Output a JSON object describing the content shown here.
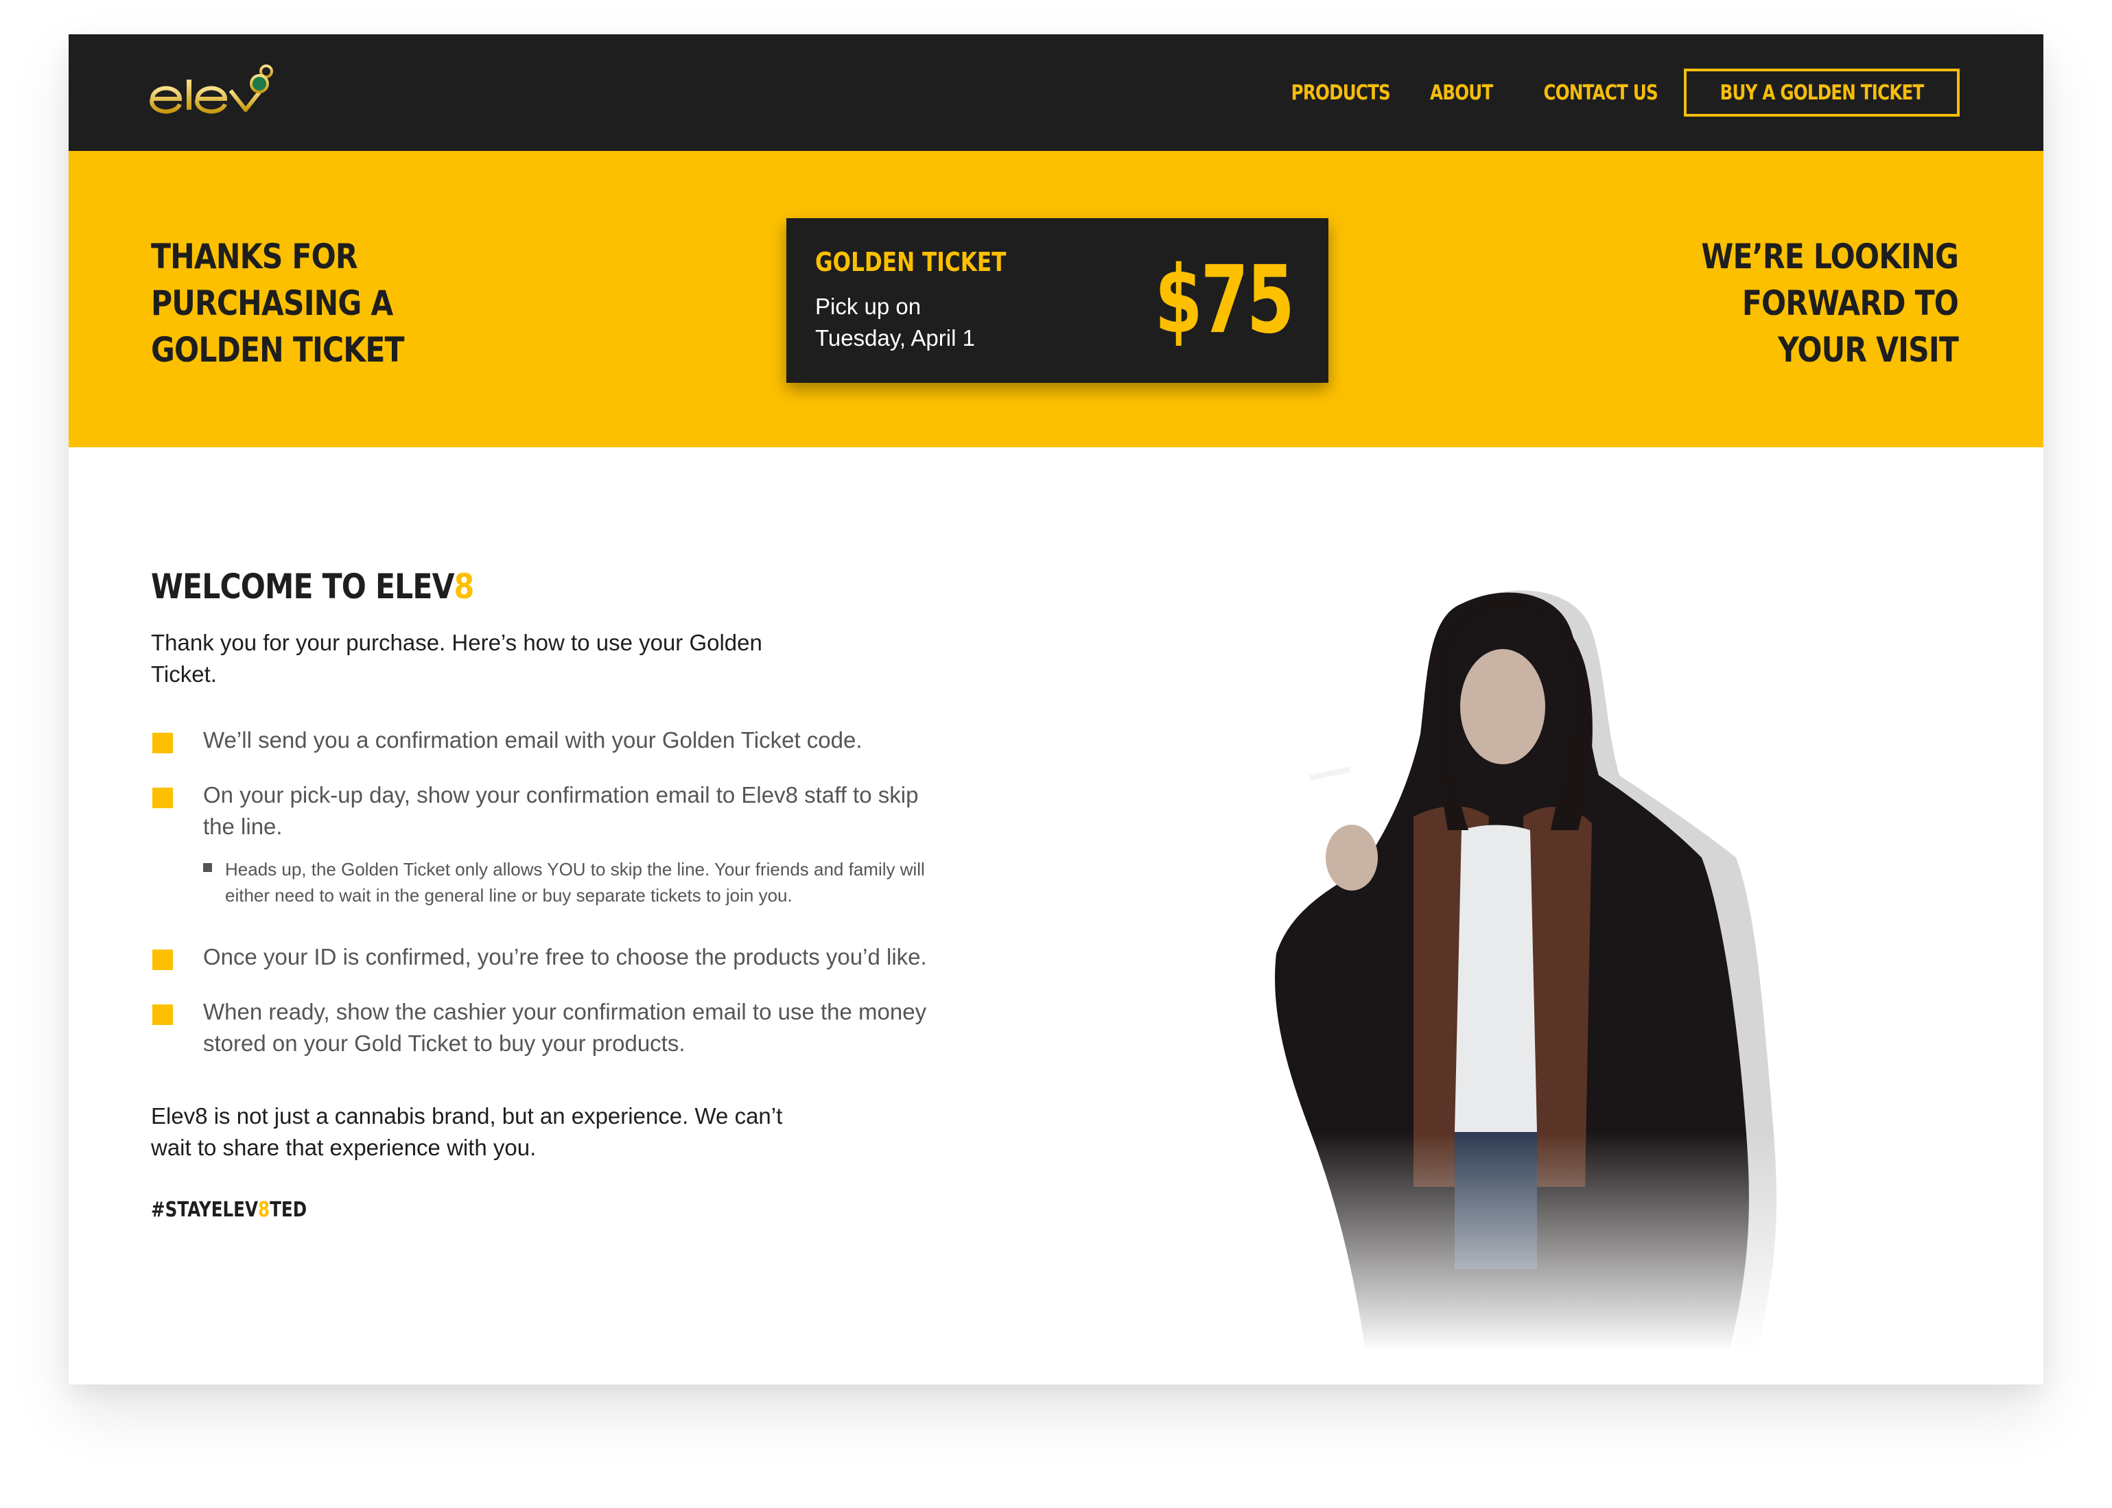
{
  "nav": {
    "logo_text": "elev8",
    "links": [
      "PRODUCTS",
      "ABOUT",
      "CONTACT US"
    ],
    "cta": "BUY A GOLDEN TICKET"
  },
  "banner": {
    "left_line1": "THANKS FOR PURCHASING A",
    "left_line2": "GOLDEN TICKET",
    "right_line1": "WE’RE LOOKING FORWARD TO",
    "right_line2": "YOUR VISIT",
    "ticket": {
      "title": "GOLDEN TICKET",
      "pickup_line1": "Pick up on",
      "pickup_line2": "Tuesday, April 1",
      "price": "$75"
    }
  },
  "content": {
    "heading_main": "WELCOME TO ELEV",
    "heading_accent": "8",
    "intro": "Thank you for your purchase. Here’s how to use your Golden Ticket.",
    "steps": [
      "We’ll send you a confirmation email with your Golden Ticket code.",
      "On your pick-up day, show your confirmation email to Elev8 staff to skip the line.",
      "Once your ID is confirmed, you’re free to choose the products you’d like.",
      "When ready, show the cashier your confirmation email to use the money stored on your Gold Ticket to buy your products."
    ],
    "note": "Heads up, the Golden Ticket only allows YOU to skip the line. Your friends and family will either need to wait in the general line or buy separate tickets to join you.",
    "outro": "Elev8 is not just a cannabis brand, but an experience. We can’t wait to share that experience with you.",
    "hashtag_pre": "#STAYELEV",
    "hashtag_accent": "8",
    "hashtag_post": "TED"
  },
  "colors": {
    "brand_yellow": "#fdc000",
    "nav_dark": "#1e1e1e",
    "body_text": "#1e1e1e",
    "muted_text": "#555555"
  }
}
